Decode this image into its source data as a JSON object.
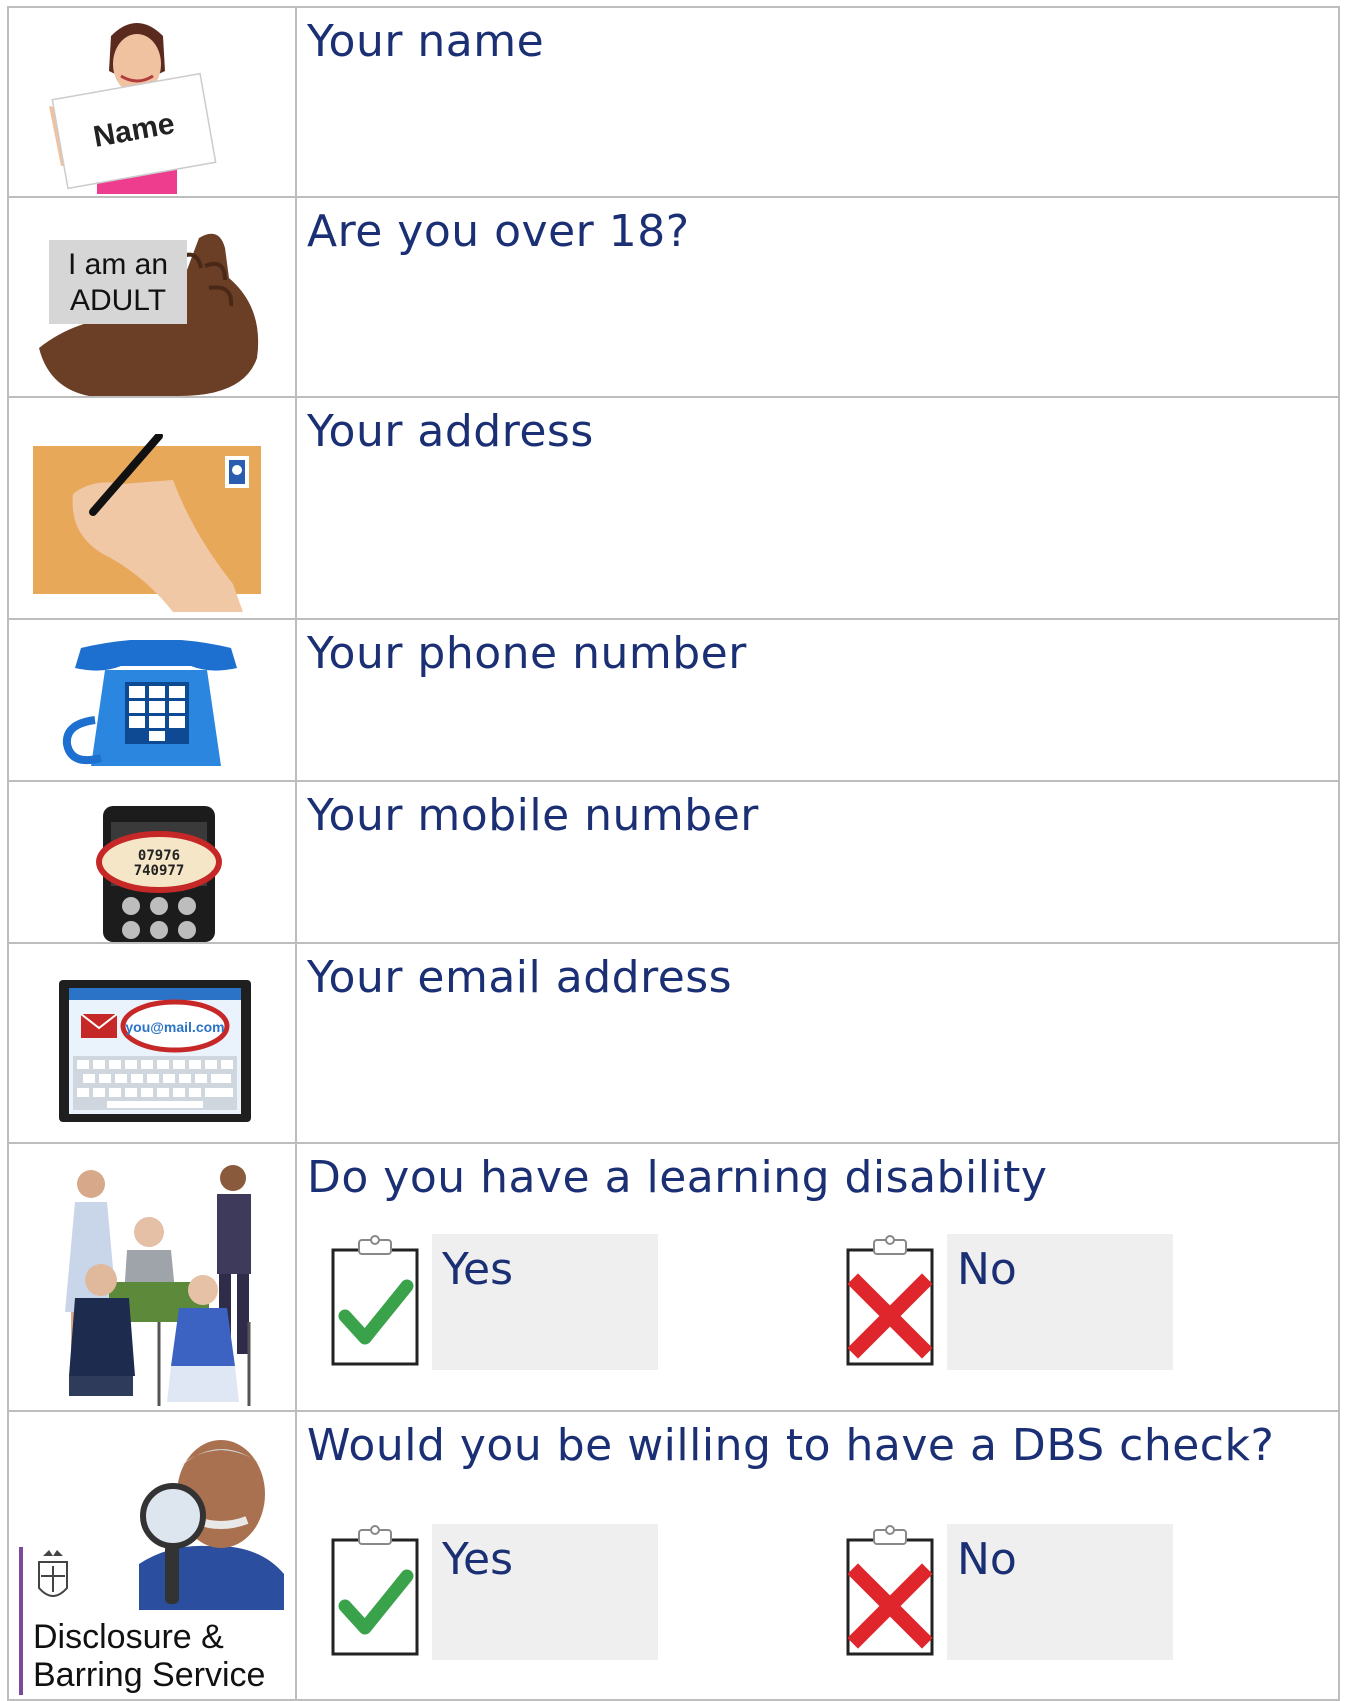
{
  "rows": [
    {
      "question": "Your name",
      "image": {
        "icon": "person-holding-name-card-icon",
        "card_text": "Name"
      }
    },
    {
      "question": "Are you over 18?",
      "image": {
        "icon": "hand-holding-adult-card-icon",
        "card_line1": "I am an",
        "card_line2": "ADULT"
      }
    },
    {
      "question": "Your address",
      "image": {
        "icon": "hand-writing-envelope-icon"
      }
    },
    {
      "question": "Your phone number",
      "image": {
        "icon": "blue-telephone-icon"
      }
    },
    {
      "question": "Your mobile number",
      "image": {
        "icon": "mobile-phone-icon",
        "number_line1": "07976",
        "number_line2": "740977"
      }
    },
    {
      "question": "Your email address",
      "image": {
        "icon": "tablet-email-icon",
        "email_text": "you@mail.com"
      }
    },
    {
      "question": "Do you have a learning disability",
      "image": {
        "icon": "group-of-people-icon"
      },
      "options": [
        {
          "label": "Yes",
          "icon": "clipboard-tick-icon"
        },
        {
          "label": "No",
          "icon": "clipboard-cross-icon"
        }
      ]
    },
    {
      "question": "Would you be willing to have a DBS check?",
      "image": {
        "icon": "man-with-magnifying-glass-icon",
        "logo_line1": "Disclosure &",
        "logo_line2": "Barring Service"
      },
      "options": [
        {
          "label": "Yes",
          "icon": "clipboard-tick-icon"
        },
        {
          "label": "No",
          "icon": "clipboard-cross-icon"
        }
      ]
    }
  ],
  "colors": {
    "text": "#1b2f74",
    "border": "#bdbdbd",
    "answer_box": "#efefef",
    "tick": "#3aa24a",
    "cross": "#e0262d"
  }
}
